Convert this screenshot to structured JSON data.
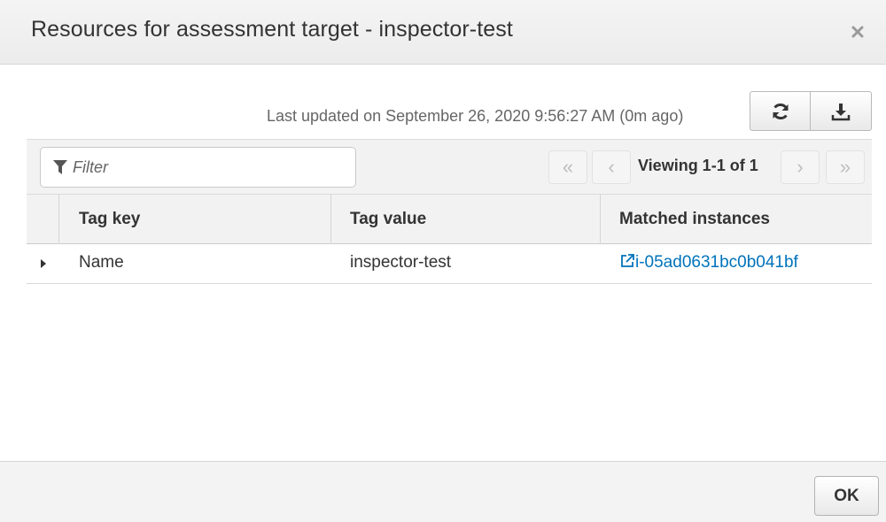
{
  "modal": {
    "title": "Resources for assessment target - inspector-test",
    "close_icon": "close-icon"
  },
  "toolbar": {
    "last_updated": "Last updated on September 26, 2020 9:56:27 AM (0m ago)",
    "refresh_icon": "refresh-icon",
    "download_icon": "download-icon"
  },
  "filter": {
    "placeholder": "Filter",
    "value": "",
    "icon": "filter-icon"
  },
  "pagination": {
    "first": "«",
    "prev": "‹",
    "next": "›",
    "last": "»",
    "viewing_text": "Viewing 1-1 of 1"
  },
  "table": {
    "columns": [
      "Tag key",
      "Tag value",
      "Matched instances"
    ],
    "rows": [
      {
        "tag_key": "Name",
        "tag_value": "inspector-test",
        "instance": "i-05ad0631bc0b041bf"
      }
    ]
  },
  "footer": {
    "ok_label": "OK"
  },
  "colors": {
    "link": "#0073bb",
    "header_bg": "#f2f2f2",
    "text": "#333333"
  }
}
